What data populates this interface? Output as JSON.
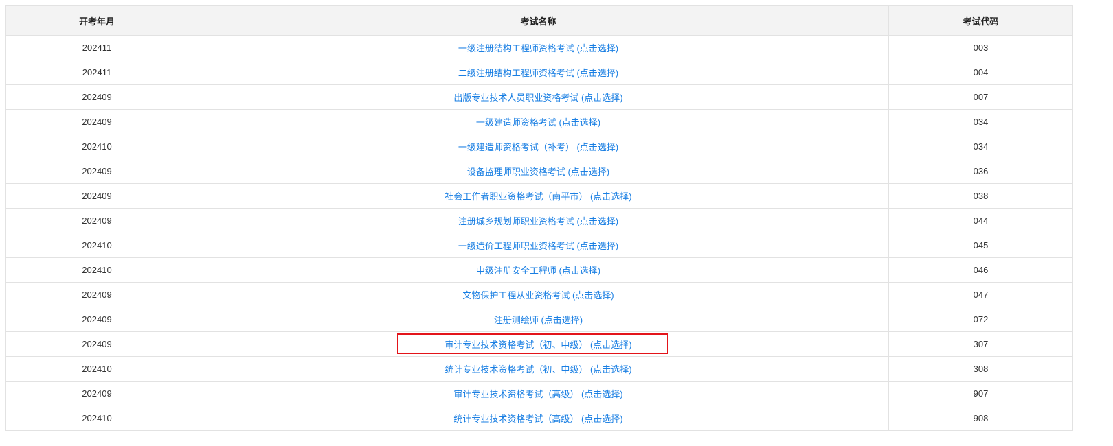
{
  "headers": {
    "month": "开考年月",
    "name": "考试名称",
    "code": "考试代码"
  },
  "rows": [
    {
      "month": "202411",
      "name": "一级注册结构工程师资格考试 (点击选择)",
      "code": "003"
    },
    {
      "month": "202411",
      "name": "二级注册结构工程师资格考试 (点击选择)",
      "code": "004"
    },
    {
      "month": "202409",
      "name": "出版专业技术人员职业资格考试 (点击选择)",
      "code": "007"
    },
    {
      "month": "202409",
      "name": "一级建造师资格考试 (点击选择)",
      "code": "034"
    },
    {
      "month": "202410",
      "name": "一级建造师资格考试（补考） (点击选择)",
      "code": "034"
    },
    {
      "month": "202409",
      "name": "设备监理师职业资格考试 (点击选择)",
      "code": "036"
    },
    {
      "month": "202409",
      "name": "社会工作者职业资格考试（南平市） (点击选择)",
      "code": "038"
    },
    {
      "month": "202409",
      "name": "注册城乡规划师职业资格考试 (点击选择)",
      "code": "044"
    },
    {
      "month": "202410",
      "name": "一级造价工程师职业资格考试 (点击选择)",
      "code": "045"
    },
    {
      "month": "202410",
      "name": "中级注册安全工程师 (点击选择)",
      "code": "046"
    },
    {
      "month": "202409",
      "name": "文物保护工程从业资格考试 (点击选择)",
      "code": "047"
    },
    {
      "month": "202409",
      "name": "注册测绘师 (点击选择)",
      "code": "072"
    },
    {
      "month": "202409",
      "name": "审计专业技术资格考试（初、中级） (点击选择)",
      "code": "307"
    },
    {
      "month": "202410",
      "name": "统计专业技术资格考试（初、中级） (点击选择)",
      "code": "308"
    },
    {
      "month": "202409",
      "name": "审计专业技术资格考试（高级） (点击选择)",
      "code": "907"
    },
    {
      "month": "202410",
      "name": "统计专业技术资格考试（高级） (点击选择)",
      "code": "908"
    }
  ],
  "highlighted_row": 12,
  "colors": {
    "link": "#1a7fe3",
    "highlight": "#e3141a",
    "header_bg": "#f3f3f3"
  }
}
